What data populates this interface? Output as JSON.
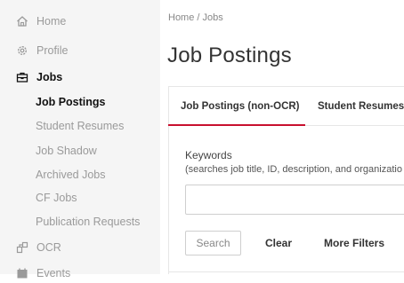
{
  "sidebar": {
    "items": [
      {
        "label": "Home",
        "icon": "home-icon"
      },
      {
        "label": "Profile",
        "icon": "gear-icon"
      },
      {
        "label": "Jobs",
        "icon": "briefcase-icon"
      },
      {
        "label": "OCR",
        "icon": "ocr-icon"
      },
      {
        "label": "Events",
        "icon": "calendar-icon"
      }
    ],
    "jobs_sub": [
      {
        "label": "Job Postings"
      },
      {
        "label": "Student Resumes"
      },
      {
        "label": "Job Shadow"
      },
      {
        "label": "Archived Jobs"
      },
      {
        "label": "CF Jobs"
      },
      {
        "label": "Publication Requests"
      }
    ]
  },
  "breadcrumb": "Home / Jobs",
  "page_title": "Job Postings",
  "tabs": [
    {
      "label": "Job Postings (non-OCR)"
    },
    {
      "label": "Student Resumes ("
    }
  ],
  "filters": {
    "keywords_label": "Keywords",
    "keywords_hint": "(searches job title, ID, description, and organizatio",
    "keywords_value": "",
    "search_label": "Search",
    "clear_label": "Clear",
    "more_filters_label": "More Filters"
  },
  "colors": {
    "accent": "#c8102e",
    "sidebar_bg": "#f5f5f5"
  }
}
